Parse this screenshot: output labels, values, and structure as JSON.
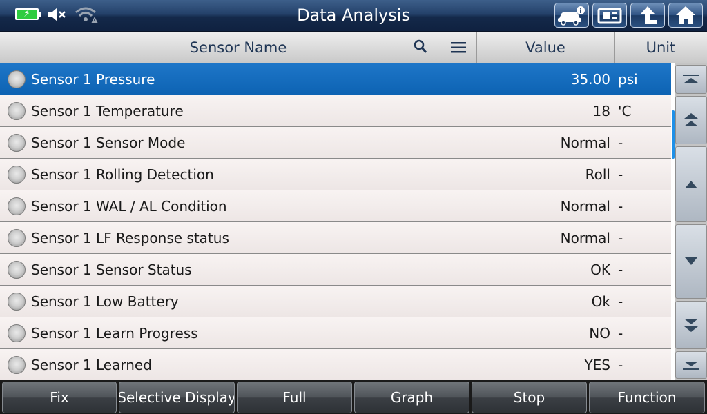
{
  "title": "Data Analysis",
  "header": {
    "sensor_name": "Sensor Name",
    "value": "Value",
    "unit": "Unit"
  },
  "rows": [
    {
      "name": "Sensor 1 Pressure",
      "value": "35.00",
      "unit": "psi",
      "selected": true
    },
    {
      "name": "Sensor 1 Temperature",
      "value": "18",
      "unit": "'C"
    },
    {
      "name": "Sensor 1 Sensor Mode",
      "value": "Normal",
      "unit": "-"
    },
    {
      "name": "Sensor 1 Rolling Detection",
      "value": "Roll",
      "unit": "-"
    },
    {
      "name": "Sensor 1 WAL / AL Condition",
      "value": "Normal",
      "unit": "-"
    },
    {
      "name": "Sensor 1 LF Response status",
      "value": "Normal",
      "unit": "-"
    },
    {
      "name": "Sensor 1 Sensor Status",
      "value": "OK",
      "unit": "-"
    },
    {
      "name": "Sensor 1 Low Battery",
      "value": "Ok",
      "unit": "-"
    },
    {
      "name": "Sensor 1 Learn Progress",
      "value": "NO",
      "unit": "-"
    },
    {
      "name": "Sensor 1 Learned",
      "value": "YES",
      "unit": "-"
    }
  ],
  "bottom_buttons": [
    "Fix",
    "Selective Display",
    "Full",
    "Graph",
    "Stop",
    "Function"
  ],
  "icons": {
    "status": [
      "battery-charging-icon",
      "speaker-muted-icon",
      "wifi-warning-icon"
    ],
    "toolbar": [
      "vehicle-info-icon",
      "screenshot-icon",
      "back-icon",
      "home-icon"
    ],
    "header": [
      "search-icon",
      "menu-icon"
    ],
    "scroll": [
      "scroll-top-icon",
      "page-up-icon",
      "scroll-up-icon",
      "scroll-down-icon",
      "page-down-icon",
      "scroll-bottom-icon"
    ]
  },
  "colors": {
    "selected_row": "#0d63b3",
    "battery": "#2ecc40",
    "scrollbar_thumb": "#1e90e8"
  }
}
